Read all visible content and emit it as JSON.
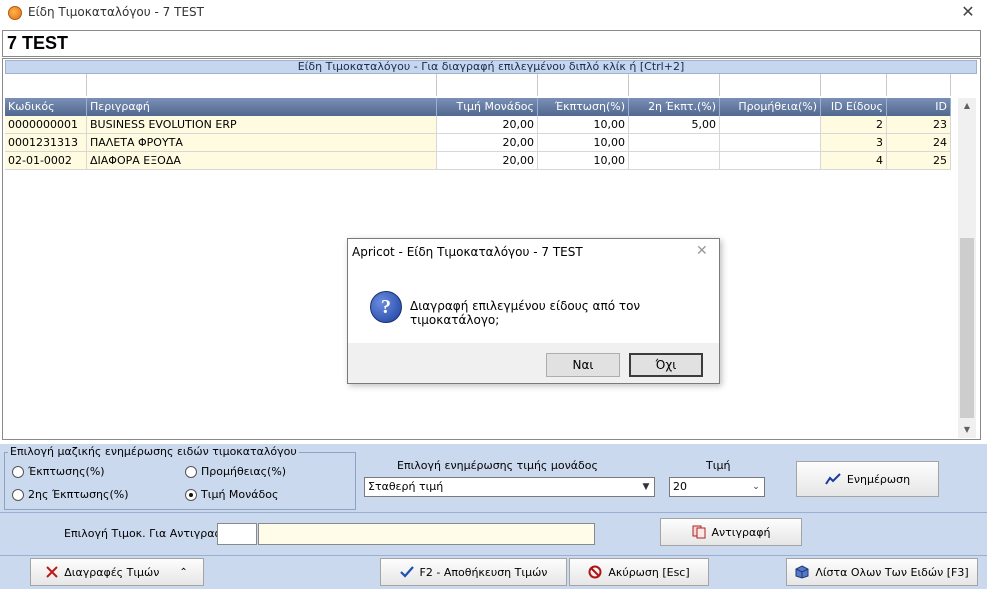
{
  "window": {
    "title": "Είδη Τιμοκαταλόγου -  7  TEST"
  },
  "header": {
    "title": "7  TEST"
  },
  "grid": {
    "caption": "Είδη Τιμοκαταλόγου - Για διαγραφή επιλεγμένου διπλό κλίκ ή [Ctrl+2]",
    "columns": [
      "Κωδικός",
      "Περιγραφή",
      "Τιμή Μονάδος",
      "Έκπτωση(%)",
      "2η Έκπτ.(%)",
      "Προμήθεια(%)",
      "ID Είδους",
      "ID"
    ],
    "rows": [
      [
        "0000000001",
        "BUSINESS EVOLUTION ERP",
        "20,00",
        "10,00",
        "5,00",
        "",
        "2",
        "23"
      ],
      [
        "0001231313",
        "ΠΑΛΕΤΑ ΦΡΟΥΤΑ",
        "20,00",
        "10,00",
        "",
        "",
        "3",
        "24"
      ],
      [
        "02-01-0002",
        "ΔΙΑΦΟΡΑ ΕΞΟΔΑ",
        "20,00",
        "10,00",
        "",
        "",
        "4",
        "25"
      ]
    ]
  },
  "bulk_update": {
    "group_title": "Επιλογή μαζικής ενημέρωσης ειδών τιμοκαταλόγου",
    "radio_discount": "Έκπτωσης(%)",
    "radio_commission": "Προμήθειας(%)",
    "radio_second_discount": "2ης Έκπτωσης(%)",
    "radio_unit_price": "Τιμή Μονάδος",
    "selected_radio": "unit_price",
    "price_option_label": "Επιλογή ενημέρωσης τιμής μονάδος",
    "price_option_value": "Σταθερή τιμή",
    "value_label": "Τιμή",
    "value_value": "20",
    "update_button": "Ενημέρωση"
  },
  "copy": {
    "label": "Επιλογή Τιμοκ. Για Αντιγραφή:",
    "code_value": "",
    "name_value": "",
    "copy_button": "Αντιγραφή"
  },
  "footer": {
    "deletions_button": "Διαγραφές Τιμών",
    "save_button": "F2 - Αποθήκευση Τιμών",
    "cancel_button": "Ακύρωση [Esc]",
    "all_items_button": "Λίστα Ολων Των Ειδών [F3]"
  },
  "dialog": {
    "title": "Apricot - Είδη Τιμοκαταλόγου - 7  TEST",
    "message": "Διαγραφή επιλεγμένου είδους από τον τιμοκατάλογο;",
    "yes_button": "Ναι",
    "no_button": "Όχι"
  },
  "icons": {
    "app": "apricot-icon",
    "question": "question-icon",
    "update": "chart-line-icon",
    "copy": "copy-icon",
    "delete": "x-icon",
    "save": "checkmark-icon",
    "cancel": "no-entry-icon",
    "list": "box-icon"
  },
  "colors": {
    "panel_bg": "#cbd9ee",
    "header_bg": "#51688f",
    "row_bg": "#fffbe1",
    "caption_bg": "#c5d6ee"
  }
}
